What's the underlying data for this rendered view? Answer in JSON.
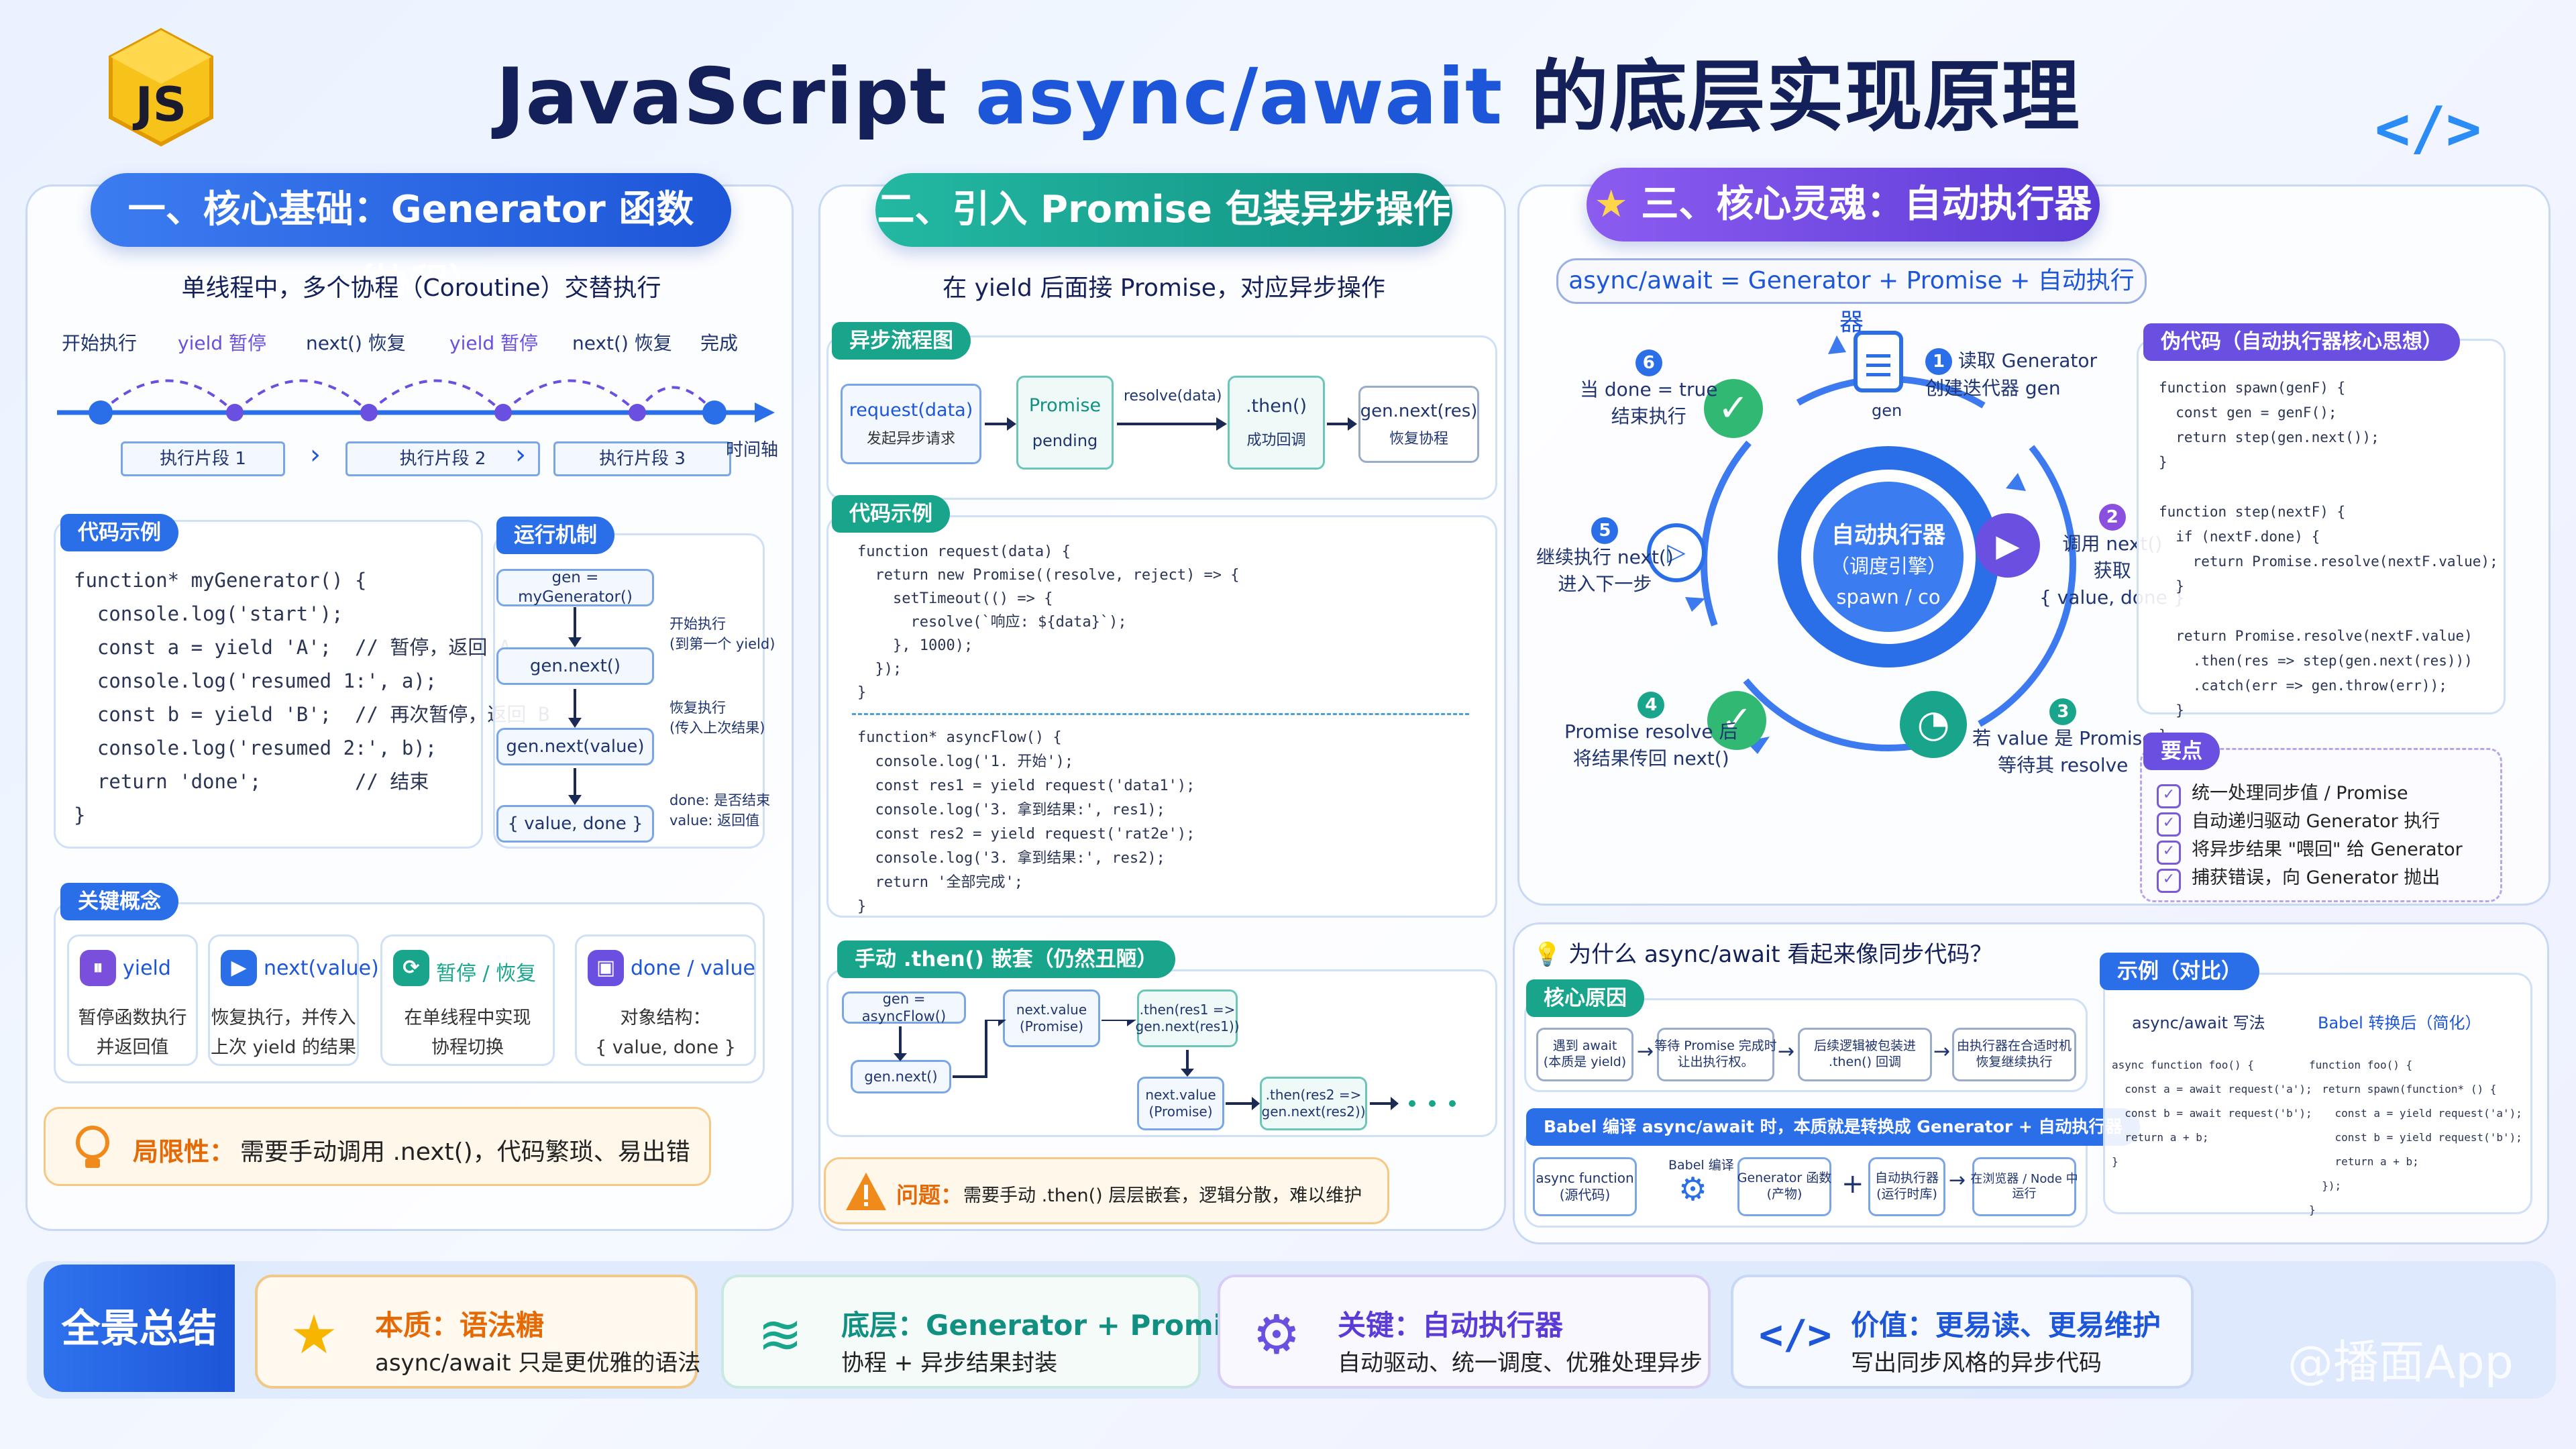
{
  "header": {
    "title_pre": "JavaScript ",
    "title_hl": "async/await",
    "title_post": " 的底层实现原理",
    "logo": "JS",
    "corner_icon": "</>"
  },
  "s1": {
    "title": "一、核心基础：Generator 函数（协程）",
    "subtitle": "单线程中，多个协程（Coroutine）交替执行",
    "timeline_labels": [
      "开始执行",
      "yield 暂停",
      "next() 恢复",
      "yield 暂停",
      "next() 恢复",
      "完成"
    ],
    "segments": [
      "执行片段 1",
      "执行片段 2",
      "执行片段 3"
    ],
    "axis": "时间轴",
    "code_tag": "代码示例",
    "code": "function* myGenerator() {\n  console.log('start');\n  const a = yield 'A';  // 暂停，返回 A\n  console.log('resumed 1:', a);\n  const b = yield 'B';  // 再次暂停，返回 B\n  console.log('resumed 2:', b);\n  return 'done';        // 结束\n}",
    "mech_tag": "运行机制",
    "mech_boxes": [
      "gen = myGenerator()",
      "gen.next()",
      "gen.next(value)",
      "{ value, done }"
    ],
    "mech_notes": [
      "开始执行\n(到第一个 yield)",
      "恢复执行\n(传入上次结果)",
      "done: 是否结束\nvalue: 返回值"
    ],
    "concepts_tag": "关键概念",
    "concepts": [
      {
        "name": "yield",
        "desc": "暂停函数执行\n并返回值"
      },
      {
        "name": "next(value)",
        "desc": "恢复执行，并传入\n上次 yield 的结果"
      },
      {
        "name": "暂停 / 恢复",
        "desc": "在单线程中实现\n协程切换"
      },
      {
        "name": "done / value",
        "desc": "对象结构：\n{ value, done }"
      }
    ],
    "limit_title": "局限性：",
    "limit_desc": "需要手动调用  .next()，代码繁琐、易出错"
  },
  "s2": {
    "title": "二、引入 Promise 包装异步操作",
    "subtitle": "在 yield 后面接 Promise，对应异步操作",
    "flow_tag": "异步流程图",
    "flow": {
      "b1": "request(data)",
      "b1s": "发起异步请求",
      "b2": "Promise",
      "b2s": "pending",
      "arrow": "resolve(data)",
      "b3": ".then()",
      "b3s": "成功回调",
      "b4": "gen.next(res)",
      "b4s": "恢复协程"
    },
    "code_tag": "代码示例",
    "code1": "function request(data) {\n  return new Promise((resolve, reject) => {\n    setTimeout(() => {\n      resolve(`响应: ${data}`);\n    }, 1000);\n  });\n}",
    "code2": "function* asyncFlow() {\n  console.log('1. 开始');\n  const res1 = yield request('data1');\n  console.log('3. 拿到结果:', res1);\n  const res2 = yield request('rat2e');\n  console.log('3. 拿到结果:', res2);\n  return '全部完成';\n}",
    "then_tag": "手动 .then() 嵌套（仍然丑陋）",
    "then_boxes": [
      "gen = asyncFlow()",
      "next.value\n(Promise)",
      ".then(res1 =>\ngen.next(res1))",
      "gen.next()",
      "next.value\n(Promise)",
      ".then(res2 =>\ngen.next(res2))"
    ],
    "problem_title": "问题：",
    "problem_desc": "需要手动 .then() 层层嵌套，逻辑分散，难以维护"
  },
  "s3": {
    "title": "三、核心灵魂：自动执行器",
    "formula": "async/await  =  Generator  +  Promise  +  自动执行器",
    "gen_label": "gen",
    "engine": [
      "自动执行器",
      "（调度引擎）",
      "spawn / co"
    ],
    "steps": [
      {
        "n": "1",
        "t": "读取 Generator\n创建迭代器 gen"
      },
      {
        "n": "2",
        "t": "调用 next()\n获取\n{ value, done }"
      },
      {
        "n": "3",
        "t": "若 value 是 Promise\n等待其 resolve"
      },
      {
        "n": "4",
        "t": "Promise resolve 后\n将结果传回 next()"
      },
      {
        "n": "5",
        "t": "继续执行 next()\n进入下一步"
      },
      {
        "n": "6",
        "t": "当 done = true\n结束执行"
      }
    ],
    "pseudo_tag": "伪代码（自动执行器核心思想）",
    "pseudo": "function spawn(genF) {\n  const gen = genF();\n  return step(gen.next());\n}\n\nfunction step(nextF) {\n  if (nextF.done) {\n    return Promise.resolve(nextF.value);\n  }\n\n  return Promise.resolve(nextF.value)\n    .then(res => step(gen.next(res)))\n    .catch(err => gen.throw(err));\n  }\n}",
    "points_tag": "要点",
    "points": [
      "统一处理同步值 / Promise",
      "自动递归驱动 Generator 执行",
      "将异步结果 \"喂回\" 给 Generator",
      "捕获错误，向 Generator 抛出"
    ]
  },
  "s4": {
    "title": "为什么  async/await  看起来像同步代码？",
    "reason_tag": "核心原因",
    "reasons": [
      "遇到 await\n(本质是 yield)",
      "等待 Promise 完成时\n让出执行权。",
      "后续逻辑被包装进\n.then() 回调",
      "由执行器在合适时机\n恢复继续执行"
    ],
    "babel_tag": "Babel 编译 async/await 时，本质就是转换成 Generator + 自动执行器",
    "babel": [
      "async function\n(源代码)",
      "Babel 编译",
      "Generator 函数\n(产物)",
      "自动执行器\n(运行时库)",
      "在浏览器 / Node 中\n运行"
    ],
    "ex_tag": "示例（对比）",
    "ex_left_title": "async/await 写法",
    "ex_right_title": "Babel 转换后（简化）",
    "ex_left": "async function foo() {\n  const a = await request('a');\n  const b = await request('b');\n  return a + b;\n}",
    "ex_right": "function foo() {\n  return spawn(function* () {\n    const a = yield request('a');\n    const b = yield request('b');\n    return a + b;\n  });\n}"
  },
  "summary": {
    "label": "全景总结",
    "items": [
      {
        "h": "本质：语法糖",
        "d": "async/await 只是更优雅的语法"
      },
      {
        "h": "底层：Generator + Promise",
        "d": "协程 + 异步结果封装"
      },
      {
        "h": "关键：自动执行器",
        "d": "自动驱动、统一调度、优雅处理异步"
      },
      {
        "h": "价值：更易读、更易维护",
        "d": "写出同步风格的异步代码"
      }
    ],
    "watermark": "@播面App"
  },
  "colors": {
    "blue": "#2b6fe8",
    "teal": "#19a58c",
    "purple": "#7a4fdc",
    "orange": "#e56a06"
  }
}
